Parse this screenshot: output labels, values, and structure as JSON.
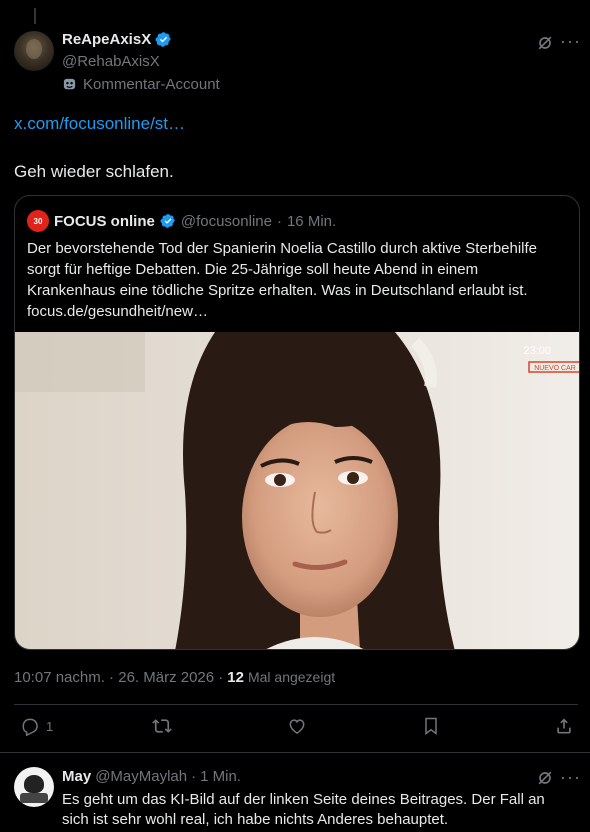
{
  "post": {
    "author": {
      "display_name": "ReApeAxisX",
      "handle": "@RehabAxisX",
      "affiliation": "Kommentar-Account"
    },
    "link_text": "x.com/focusonline/st…",
    "text": "Geh wieder schlafen.",
    "quote": {
      "avatar_text": "30",
      "name": "FOCUS online",
      "handle": "@focusonline",
      "separator": "·",
      "time": "16 Min.",
      "text": "Der bevorstehende Tod der Spanierin Noelia Castillo durch aktive Sterbehilfe sorgt für heftige Debatten. Die 25-Jährige soll heute Abend in einem Krankenhaus eine tödliche Spritze erhalten. Was in Deutschland erlaubt ist. focus.de/gesundheit/new…",
      "image_overlay": {
        "clock": "23:00",
        "badge": "NUEVO CAR"
      }
    },
    "meta": {
      "timestamp": "10:07 nachm. · 26. März 2026 ·",
      "views_count": "12",
      "views_label": "Mal angezeigt"
    },
    "actions": {
      "replies": "1",
      "reposts": "",
      "likes": ""
    }
  },
  "reply": {
    "name": "May",
    "handle": "@MayMaylah",
    "separator": "·",
    "time": "1 Min.",
    "text": "Es geht um das KI-Bild auf der linken Seite deines Beitrages. Der Fall an sich ist sehr wohl real, ich habe nichts Anderes behauptet."
  },
  "icons": {
    "verified": "verified-badge-icon",
    "affiliation": "mask-icon",
    "grok": "grok-icon",
    "more": "more-icon",
    "reply": "reply-icon",
    "repost": "repost-icon",
    "like": "like-icon",
    "bookmark": "bookmark-icon",
    "share": "share-icon"
  },
  "colors": {
    "background": "#000000",
    "text": "#e7e9ea",
    "secondary": "#71767b",
    "link": "#1d9bf0",
    "border": "#2f3336",
    "verified": "#1d9bf0"
  }
}
